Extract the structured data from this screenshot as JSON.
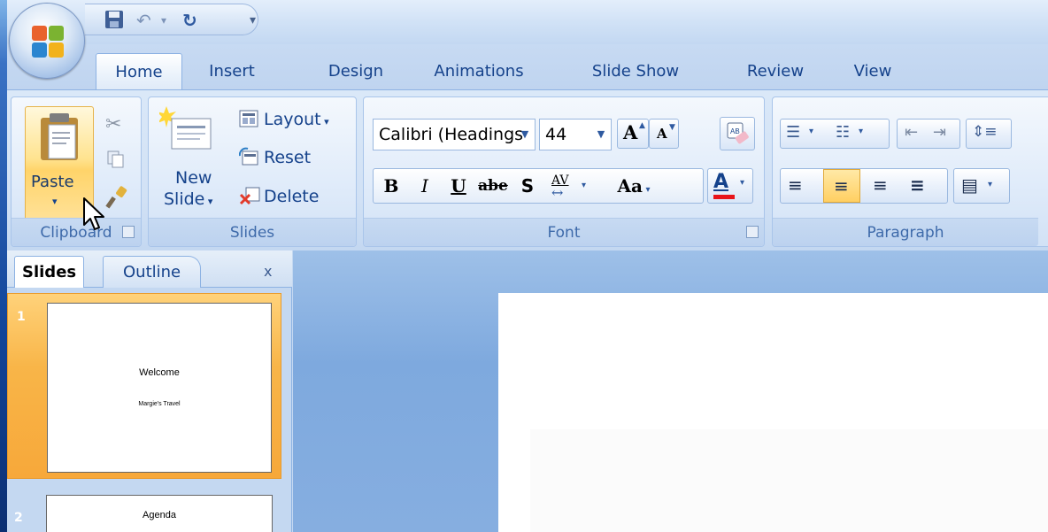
{
  "tabs": [
    "Home",
    "Insert",
    "Design",
    "Animations",
    "Slide Show",
    "Review",
    "View"
  ],
  "clipboard": {
    "paste_label": "Paste",
    "group_label": "Clipboard"
  },
  "slides_group": {
    "new_label": "New",
    "slide_label": "Slide",
    "layout_label": "Layout",
    "reset_label": "Reset",
    "delete_label": "Delete",
    "group_label": "Slides"
  },
  "font_group": {
    "font_name": "Calibri (Headings",
    "font_size": "44",
    "group_label": "Font",
    "bold": "B",
    "italic": "I",
    "underline": "U",
    "strike": "abe",
    "shadow": "S",
    "spacing": "AV",
    "case": "Aa",
    "color_letter": "A",
    "grow": "A",
    "shrink": "A"
  },
  "paragraph_group": {
    "group_label": "Paragraph"
  },
  "pane": {
    "tab_slides": "Slides",
    "tab_outline": "Outline",
    "close": "x"
  },
  "thumbnails": [
    {
      "number": "1",
      "title": "Welcome",
      "subtitle": "Margie's Travel"
    },
    {
      "number": "2",
      "title": "Agenda"
    }
  ],
  "colors": {
    "accent_orange": "#f7a83a",
    "ribbon_text": "#15428b",
    "font_color_bar": "#e8141a"
  }
}
